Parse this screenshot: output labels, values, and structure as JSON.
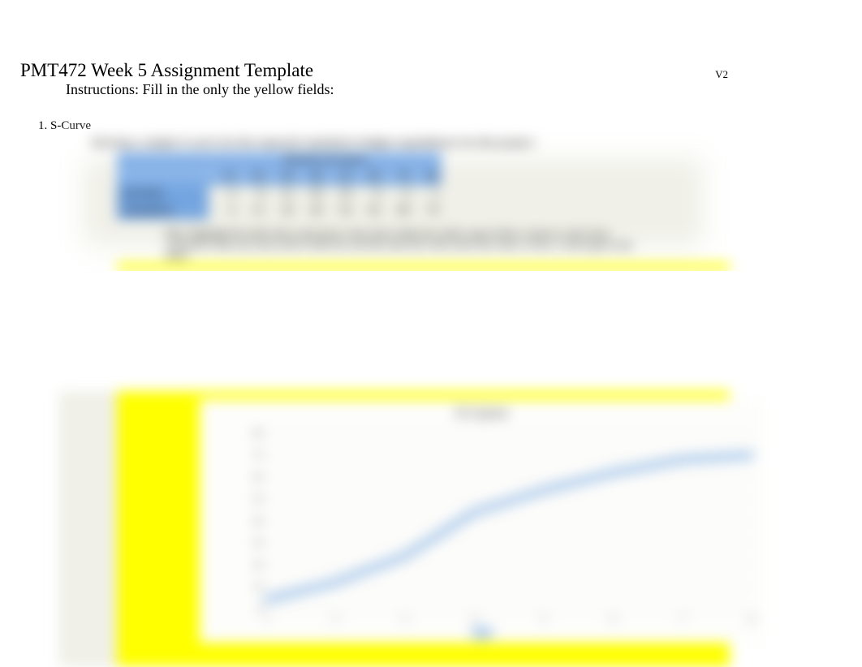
{
  "title": "PMT472 Week 5 Assignment Template",
  "version": "V2",
  "instructions": "Instructions: Fill in the only the yellow fields:",
  "section_label": "1. S-Curve",
  "develop_line": "Develop a simple S-curve for the expected cumulative budget expenditures for this project:",
  "table": {
    "duration_label": "Duration (in days)",
    "headers": [
      "10",
      "20",
      "30",
      "40",
      "50",
      "60",
      "70",
      "80"
    ],
    "rows": [
      {
        "label": "Activities",
        "vals": [
          "4",
          "8",
          "12",
          "20",
          "10",
          "8",
          "6",
          "2"
        ]
      },
      {
        "label": "Cumulative",
        "vals": [
          "4",
          "12",
          "24",
          "44",
          "54",
          "62",
          "68",
          "70"
        ]
      }
    ]
  },
  "hint": "Hint: Highlight the table above and insert a line chart within the yellow space below, ensure to only show cumulative data (you may need to hide the activities data first, then insert line chart, to have a chart ignore that data).",
  "chart_data": {
    "type": "line",
    "title": "S Curve",
    "x": [
      1,
      2,
      3,
      4,
      5,
      6,
      7,
      8
    ],
    "values": [
      4,
      12,
      24,
      44,
      54,
      62,
      68,
      70
    ],
    "ylim": [
      0,
      80
    ],
    "yticks": [
      0,
      10,
      20,
      30,
      40,
      50,
      60,
      70,
      80
    ],
    "xticks": [
      1,
      2,
      3,
      4,
      5,
      6,
      7,
      8
    ],
    "xlabel": "",
    "ylabel": ""
  }
}
